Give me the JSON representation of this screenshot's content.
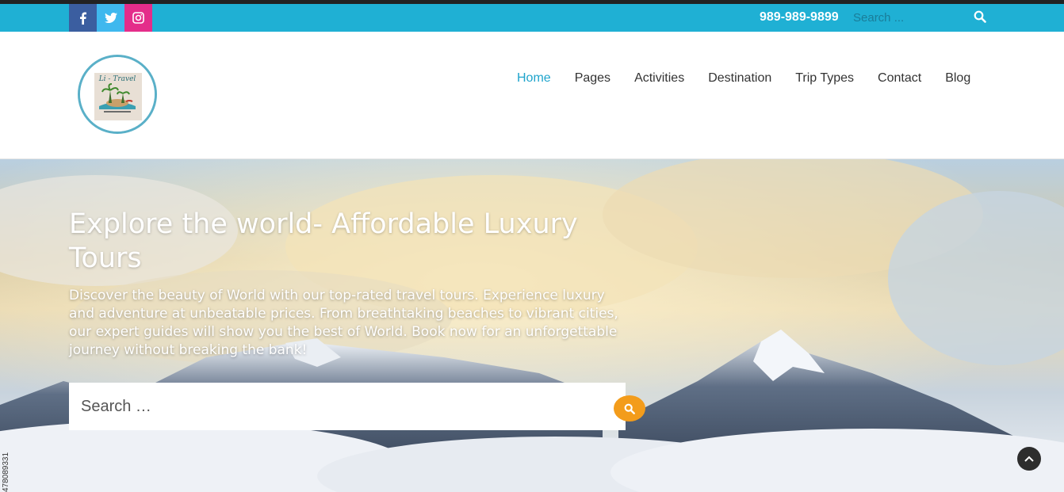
{
  "topbar": {
    "phone": "989-989-9899",
    "search_placeholder": "Search ...",
    "social": [
      "facebook-icon",
      "twitter-icon",
      "instagram-icon"
    ],
    "accent": "#1fb0d4"
  },
  "header": {
    "logo_text": "Li - Travel",
    "nav": [
      {
        "label": "Home",
        "active": true
      },
      {
        "label": "Pages"
      },
      {
        "label": "Activities"
      },
      {
        "label": "Destination"
      },
      {
        "label": "Trip Types"
      },
      {
        "label": "Contact"
      },
      {
        "label": "Blog"
      }
    ],
    "active_color": "#1fa4cc"
  },
  "hero": {
    "title": "Explore the world- Affordable Luxury Tours",
    "description": "Discover the beauty of World with our top-rated travel tours. Experience luxury and adventure at unbeatable prices. From breathtaking beaches to vibrant cities, our expert guides will show you the best of World. Book now for an unforgettable journey without breaking the bank!",
    "search_placeholder": "Search …",
    "search_button_color": "#f39c1b",
    "side_id": "478089331"
  }
}
